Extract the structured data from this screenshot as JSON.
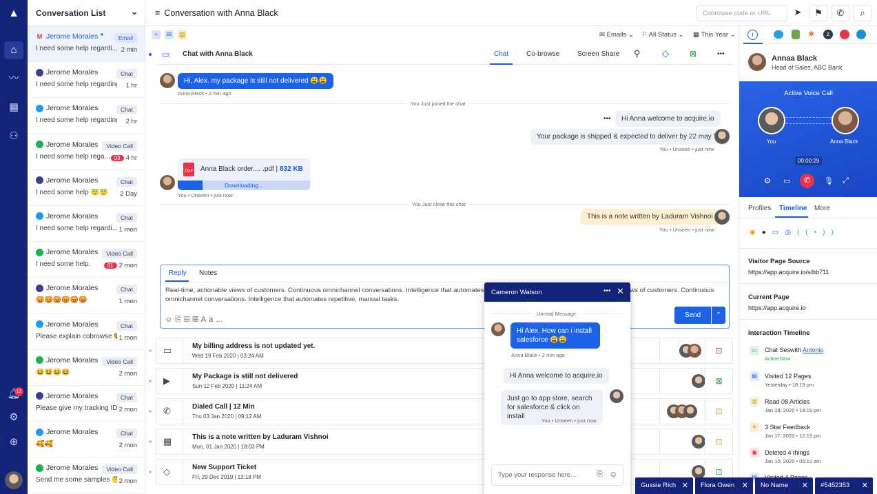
{
  "sidebar": {
    "notif_count": "12"
  },
  "conv_list": {
    "title": "Conversation List",
    "items": [
      {
        "name": "Jerome Morales",
        "tag": "Email",
        "preview": "I need some help regardi...",
        "time": "2 min",
        "channel": "gmail-icon",
        "badge": ""
      },
      {
        "name": "Jerome Morales",
        "tag": "Chat",
        "preview": "I need some help regarding...",
        "time": "1 hr",
        "channel": "chat-icon",
        "badge": ""
      },
      {
        "name": "Jerome Morales",
        "tag": "Chat",
        "preview": "I need some help regarding...",
        "time": "2 hr",
        "channel": "twitter-icon",
        "badge": ""
      },
      {
        "name": "Jerome Morales",
        "tag": "Video Call",
        "preview": "I need some help rega...",
        "time": "4 hr",
        "channel": "video-icon",
        "badge": "03"
      },
      {
        "name": "Jerome Morales",
        "tag": "Chat",
        "preview": "I need some help 😇😇",
        "time": "2 Day",
        "channel": "chat-icon",
        "badge": ""
      },
      {
        "name": "Jerome Morales",
        "tag": "Chat",
        "preview": "I need some help regardi...",
        "time": "1 mon",
        "channel": "twitter-icon",
        "badge": ""
      },
      {
        "name": "Jerome Morales",
        "tag": "Video Call",
        "preview": "I need some help.",
        "time": "2 mon",
        "channel": "video-icon",
        "badge": "01"
      },
      {
        "name": "Jerome Morales",
        "tag": "Chat",
        "preview": "😡😡😡😡😡😡",
        "time": "1 mon",
        "channel": "chat-icon",
        "badge": ""
      },
      {
        "name": "Jerome Morales",
        "tag": "Chat",
        "preview": "Please explain cobrowse 🤓",
        "time": "1 mon",
        "channel": "twitter-icon",
        "badge": ""
      },
      {
        "name": "Jerome Morales",
        "tag": "Video Call",
        "preview": "😆😆😆😆",
        "time": "2 mon",
        "channel": "video-icon",
        "badge": ""
      },
      {
        "name": "Jerome Morales",
        "tag": "Chat",
        "preview": "Please give my tracking ID.",
        "time": "2 mon",
        "channel": "chat-icon",
        "badge": ""
      },
      {
        "name": "Jerome Morales",
        "tag": "Chat",
        "preview": "🥰🥰",
        "time": "2 mon",
        "channel": "twitter-icon",
        "badge": ""
      },
      {
        "name": "Jerome Morales",
        "tag": "Video Call",
        "preview": "Send me some samples 🤔",
        "time": "2 mon",
        "channel": "video-icon",
        "badge": ""
      }
    ]
  },
  "header": {
    "title": "Conversation with Anna Black",
    "cobrowse_placeholder": "Cobrowse code or URL"
  },
  "filters": {
    "emails": "Emails",
    "status": "All Status",
    "period": "This Year"
  },
  "chat": {
    "title": "Chat with Anna Black",
    "tabs": [
      "Chat",
      "Co-browse",
      "Screen Share"
    ],
    "m1": "Hi, Alex. my package is still not delivered 😩😩",
    "m1_meta": "Anna Black  •  2 min ago",
    "sys1": "You Just joined the chat",
    "m2": "Hi Anna welcome to acquire.io",
    "m3": "Your package is shipped & expected to deliver by 22 may '19",
    "m3_meta": "You • Unseen • just now",
    "file_name": "Anna Black order.... .pdf  |",
    "file_size": "832 KB",
    "file_status": "Downloading...",
    "file_meta": "You • Unseen • just now",
    "sys2": "You Just close this chat",
    "note": "This is a note written by Laduram Vishnoi",
    "note_meta": "You • Unseen • just now"
  },
  "reply": {
    "tab_reply": "Reply",
    "tab_notes": "Notes",
    "text": "Real-time, actionable views of customers. Continuous omnichannel conversations. Intelligence that automates repetitive, manual tasks. Real-time, actionable views of customers. Continuous omnichannel conversations. Intelligence that automates repetitive, manual tasks.",
    "send": "Send"
  },
  "timeline_rows": [
    {
      "title": "My billing address is not updated yet.",
      "date": "Wed 19 Feb 2020  |  03:24 AM"
    },
    {
      "title": "My Package is still not delivered",
      "date": "Sun 12 Feb 2020  |  11:24 AM"
    },
    {
      "title": "Dialed Call  |  12 Min",
      "date": "Thu 03 Jan 2020  |  09:12 AM"
    },
    {
      "title": "This is a note written by Laduram Vishnoi",
      "date": "Mon, 01 Jan 2020  |  18:03 PM"
    },
    {
      "title": "New Support Ticket",
      "date": "Fri, 29 Dec 2019  |  13:18 PM"
    }
  ],
  "profile": {
    "name": "Annaa Black",
    "role": "Head of Sales, ABC Bank",
    "call_title": "Active Voice Call",
    "you": "You",
    "other": "Anna Black",
    "timer": "00:00:29",
    "tabs": [
      "Profiles",
      "Timeline",
      "More"
    ],
    "source_label": "Visitor Page Source",
    "source_url": "https://app.acquire.io/s/bb711",
    "current_label": "Current Page",
    "current_url": "https://app.acquire.io",
    "it_label": "Interaction Timeline",
    "it": [
      {
        "t": "Chat Seswith ",
        "link": "Antonio",
        "s": "Active Now"
      },
      {
        "t": "Visited 12 Pages",
        "s": "Yesterday  •  18:19 pm"
      },
      {
        "t": "Read 08 Articles",
        "s": "Jan 18, 2020  •  18:19 pm"
      },
      {
        "t": "3 Star Feedback",
        "s": "Jan 17, 2020  •  12:19 pm"
      },
      {
        "t": "Deleted 4 things",
        "s": "Jan 10, 2020  •  05:12 am"
      },
      {
        "t": "Visited 4 Pages",
        "s": ""
      }
    ]
  },
  "popup": {
    "name": "Cameron Watson",
    "unread": "Unread Message",
    "m1": "Hi Alex, How can i install salesforce 😩😩",
    "m1_meta": "Anna Black  •  2 min ago",
    "m2": "Hi Anna welcome to acquire.io",
    "m3": "Just go to app store, search for salesforce & click on install",
    "m3_meta": "You •  Unseen •  just now",
    "placeholder": "Type your response here..."
  },
  "chips": [
    "Gussie Rich",
    "Flora Owen",
    "No Name",
    "#5452353"
  ]
}
